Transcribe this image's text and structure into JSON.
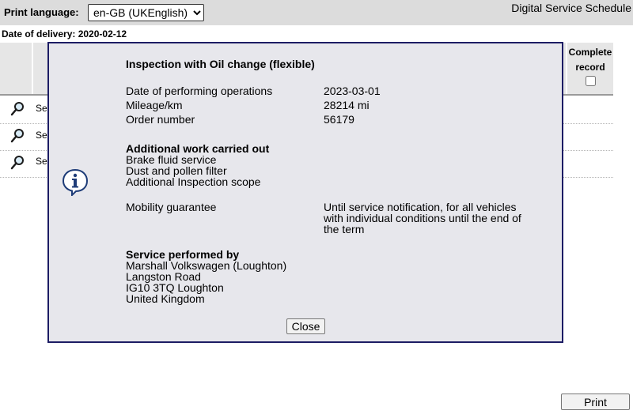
{
  "header": {
    "print_language_label": "Print language:",
    "language_selected": "en-GB (UKEnglish)",
    "app_title": "Digital Service Schedule"
  },
  "delivery_date": "Date of delivery: 2020-02-12",
  "table": {
    "complete_record_label_line1": "Complete",
    "complete_record_label_line2": "record",
    "complete_record_checked": false,
    "rows": [
      {
        "label": "Se",
        "icon": "magnifier-icon"
      },
      {
        "label": "Se",
        "icon": "magnifier-icon"
      },
      {
        "label": "Se",
        "icon": "magnifier-icon"
      }
    ]
  },
  "dialog": {
    "icon": "info-icon",
    "title": "Inspection with Oil change (flexible)",
    "fields": [
      {
        "label": "Date of performing operations",
        "value": "2023-03-01"
      },
      {
        "label": "Mileage/km",
        "value": "28214 mi"
      },
      {
        "label": "Order number",
        "value": "56179"
      }
    ],
    "additional_work": {
      "heading": "Additional work carried out",
      "items": [
        "Brake fluid service",
        "Dust and pollen filter",
        "Additional Inspection scope"
      ]
    },
    "mobility": {
      "heading": "Mobility guarantee",
      "value_lines": [
        "Until service notification, for all vehicles",
        "with individual conditions until the end of",
        "the term"
      ]
    },
    "service_by": {
      "heading": "Service performed by",
      "lines": [
        "Marshall Volkswagen (Loughton)",
        "Langston Road",
        "IG10 3TQ Loughton",
        "United Kingdom"
      ]
    },
    "close_label": "Close"
  },
  "print_label": "Print",
  "colors": {
    "dialog_border": "#1c1c64",
    "dialog_background": "#e7e7ec",
    "header_background": "#dcdcdc",
    "info_icon_blue": "#1e3c78"
  }
}
